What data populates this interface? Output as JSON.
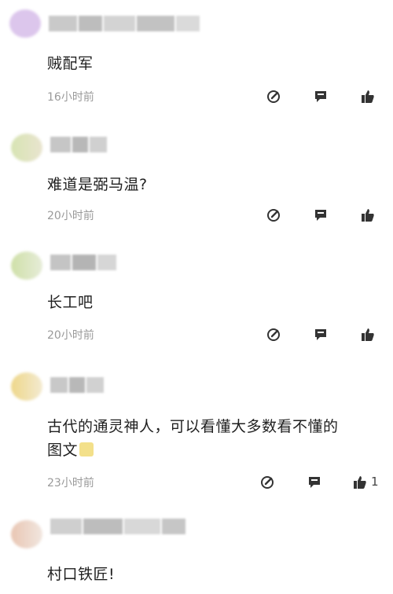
{
  "comments": [
    {
      "text": "贼配军",
      "time": "16小时前",
      "likes": ""
    },
    {
      "text": "难道是弼马温?",
      "time": "20小时前",
      "likes": ""
    },
    {
      "text": "长工吧",
      "time": "20小时前",
      "likes": ""
    },
    {
      "text_line1": "古代的通灵神人，可以看懂大多数看不懂的",
      "text_line2": "图文",
      "time": "23小时前",
      "likes": "1"
    },
    {
      "text": "村口铁匠!",
      "time": "",
      "likes": ""
    }
  ],
  "icons": {
    "edit": "edit-icon",
    "reply": "comment-icon",
    "like": "thumbs-up-icon"
  }
}
